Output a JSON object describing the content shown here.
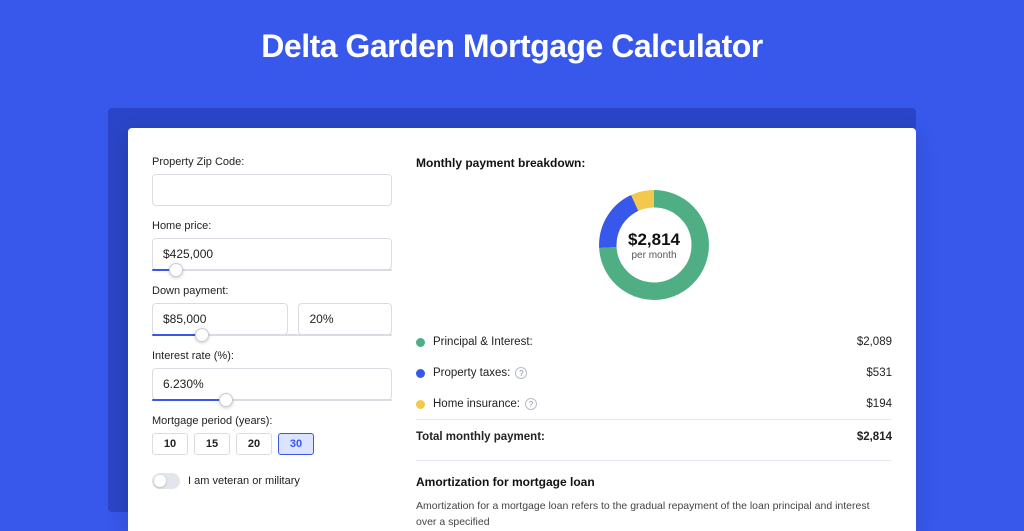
{
  "title": "Delta Garden Mortgage Calculator",
  "form": {
    "zip_label": "Property Zip Code:",
    "zip_value": "",
    "home_price_label": "Home price:",
    "home_price_value": "$425,000",
    "home_price_slider_pct": 10,
    "down_payment_label": "Down payment:",
    "down_payment_value": "$85,000",
    "down_payment_pct": "20%",
    "down_payment_slider_pct": 21,
    "interest_label": "Interest rate (%):",
    "interest_value": "6.230%",
    "interest_slider_pct": 31,
    "period_label": "Mortgage period (years):",
    "periods": [
      "10",
      "15",
      "20",
      "30"
    ],
    "period_selected": "30",
    "veteran_label": "I am veteran or military",
    "veteran_on": false
  },
  "breakdown": {
    "title": "Monthly payment breakdown:",
    "total_value": "$2,814",
    "total_sub": "per month",
    "items": [
      {
        "label": "Principal & Interest:",
        "value": "$2,089",
        "color": "#4fae83",
        "pct": 74,
        "info": false
      },
      {
        "label": "Property taxes:",
        "value": "$531",
        "color": "#3858ec",
        "pct": 19,
        "info": true
      },
      {
        "label": "Home insurance:",
        "value": "$194",
        "color": "#f2c94c",
        "pct": 7,
        "info": true
      }
    ],
    "total_label": "Total monthly payment:"
  },
  "amortization": {
    "title": "Amortization for mortgage loan",
    "text": "Amortization for a mortgage loan refers to the gradual repayment of the loan principal and interest over a specified"
  },
  "chart_data": {
    "type": "pie",
    "title": "Monthly payment breakdown",
    "series": [
      {
        "name": "Principal & Interest",
        "value": 2089,
        "color": "#4fae83"
      },
      {
        "name": "Property taxes",
        "value": 531,
        "color": "#3858ec"
      },
      {
        "name": "Home insurance",
        "value": 194,
        "color": "#f2c94c"
      }
    ],
    "total": 2814,
    "center_label": "$2,814 per month"
  }
}
